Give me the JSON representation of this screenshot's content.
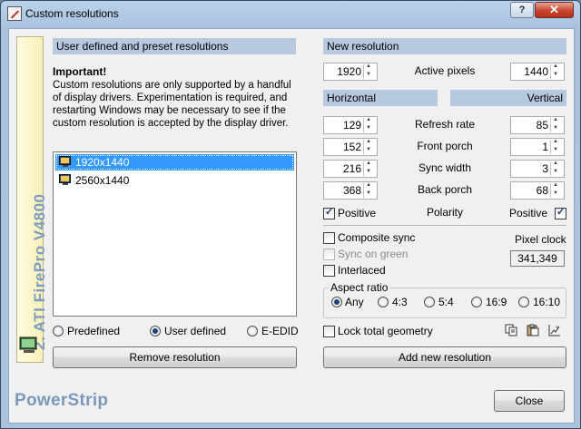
{
  "window": {
    "title": "Custom resolutions",
    "help_label": "?",
    "close_glyph": "✕"
  },
  "sidebar": {
    "label": "2. ATI FirePro V4800"
  },
  "left": {
    "section_header": "User defined and preset resolutions",
    "important_title": "Important!",
    "important_text": "Custom resolutions are only supported by a handful of display drivers. Experimentation is required, and restarting Windows may be necessary to see if the custom resolution is accepted by the display driver.",
    "resolutions": [
      {
        "label": "1920x1440",
        "selected": true
      },
      {
        "label": "2560x1440",
        "selected": false
      }
    ],
    "radios": [
      {
        "label": "Predefined",
        "checked": false
      },
      {
        "label": "User defined",
        "checked": true
      },
      {
        "label": "E-EDID",
        "checked": false
      }
    ],
    "remove_button": "Remove resolution"
  },
  "right": {
    "section_header": "New resolution",
    "active_pixels": {
      "label": "Active pixels",
      "h": "1920",
      "v": "1440"
    },
    "horizontal_header": "Horizontal",
    "vertical_header": "Vertical",
    "rows": [
      {
        "label": "Refresh rate",
        "h": "129",
        "v": "85"
      },
      {
        "label": "Front porch",
        "h": "152",
        "v": "1"
      },
      {
        "label": "Sync width",
        "h": "216",
        "v": "3"
      },
      {
        "label": "Back porch",
        "h": "368",
        "v": "68"
      }
    ],
    "polarity": {
      "label": "Polarity",
      "h_label": "Positive",
      "h_checked": true,
      "v_label": "Positive",
      "v_checked": true
    },
    "options": [
      {
        "label": "Composite sync",
        "checked": false,
        "disabled": false
      },
      {
        "label": "Sync on green",
        "checked": false,
        "disabled": true
      },
      {
        "label": "Interlaced",
        "checked": false,
        "disabled": false
      }
    ],
    "pixel_clock": {
      "label": "Pixel clock",
      "value": "341,349"
    },
    "aspect": {
      "title": "Aspect ratio",
      "options": [
        {
          "label": "Any",
          "checked": true
        },
        {
          "label": "4:3",
          "checked": false
        },
        {
          "label": "5:4",
          "checked": false
        },
        {
          "label": "16:9",
          "checked": false
        },
        {
          "label": "16:10",
          "checked": false
        }
      ]
    },
    "lock_geometry": {
      "label": "Lock total geometry",
      "checked": false
    },
    "tool_icons": [
      "copy-icon",
      "paste-icon",
      "chart-icon"
    ],
    "add_button": "Add new resolution"
  },
  "footer": {
    "brand": "PowerStrip",
    "close_button": "Close"
  }
}
